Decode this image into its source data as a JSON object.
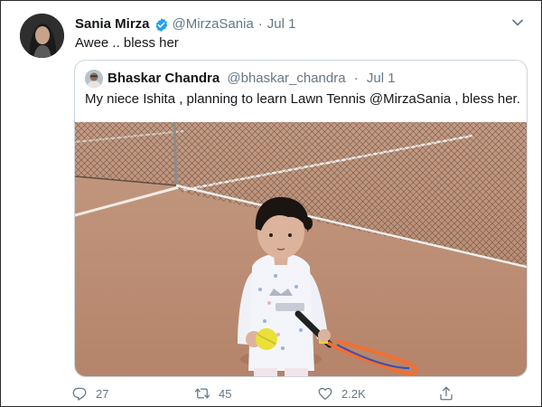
{
  "tweet": {
    "author_name": "Sania Mirza",
    "author_handle": "@MirzaSania",
    "separator": "·",
    "date": "Jul 1",
    "text": "Awee .. bless her",
    "icons": {
      "verified": "verified-badge-icon",
      "more": "chevron-down-icon"
    }
  },
  "quoted": {
    "author_name": "Bhaskar Chandra",
    "author_handle": "@bhaskar_chandra",
    "separator": "·",
    "date": "Jul 1",
    "text": "My niece Ishita , planning to learn Lawn Tennis @MirzaSania , bless her."
  },
  "actions": {
    "reply_count": "27",
    "retweet_count": "45",
    "like_count": "2.2K",
    "icons": [
      "reply-icon",
      "retweet-icon",
      "like-icon",
      "share-icon"
    ]
  },
  "colors": {
    "name_text": "#14171a",
    "secondary_text": "#657786",
    "verified_blue": "#1da1f2",
    "border": "#ccd6dd",
    "court_clay": "#b98b72"
  }
}
